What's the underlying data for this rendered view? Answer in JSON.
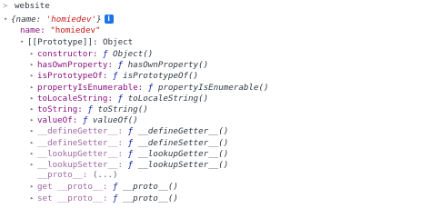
{
  "prompt_glyph": ">",
  "input": {
    "command": "website"
  },
  "object": {
    "toggle": "▾",
    "preview_open": "{name: ",
    "preview_value": "'homiedev'",
    "preview_close": "}",
    "info_badge": "i",
    "name_key": "name:",
    "name_value": "\"homiedev\"",
    "prototype": {
      "toggle": "▾",
      "label": "[[Prototype]]: Object",
      "items": [
        {
          "key": "constructor:",
          "f": "ƒ",
          "sig": "Object()"
        },
        {
          "key": "hasOwnProperty:",
          "f": "ƒ",
          "sig": "hasOwnProperty()"
        },
        {
          "key": "isPrototypeOf:",
          "f": "ƒ",
          "sig": "isPrototypeOf()"
        },
        {
          "key": "propertyIsEnumerable:",
          "f": "ƒ",
          "sig": "propertyIsEnumerable()"
        },
        {
          "key": "toLocaleString:",
          "f": "ƒ",
          "sig": "toLocaleString()"
        },
        {
          "key": "toString:",
          "f": "ƒ",
          "sig": "toString()"
        },
        {
          "key": "valueOf:",
          "f": "ƒ",
          "sig": "valueOf()"
        },
        {
          "key": "__defineGetter__:",
          "f": "ƒ",
          "sig": "__defineGetter__()"
        },
        {
          "key": "__defineSetter__:",
          "f": "ƒ",
          "sig": "__defineSetter__()"
        },
        {
          "key": "__lookupGetter__:",
          "f": "ƒ",
          "sig": "__lookupGetter__()"
        },
        {
          "key": "__lookupSetter__:",
          "f": "ƒ",
          "sig": "__lookupSetter__()"
        }
      ],
      "proto_line": {
        "key": "__proto__:",
        "value": "(...)"
      },
      "accessors": [
        {
          "key": "get __proto__:",
          "f": "ƒ",
          "sig": "__proto__()"
        },
        {
          "key": "set __proto__:",
          "f": "ƒ",
          "sig": "__proto__()"
        }
      ]
    }
  },
  "colors": {
    "key": "#881280",
    "string": "#c41a16",
    "function_marker": "#0d22aa",
    "badge": "#1a73e8"
  }
}
